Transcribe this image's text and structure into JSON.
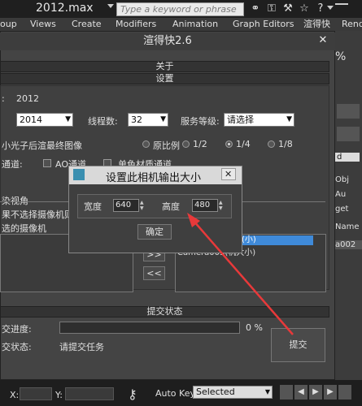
{
  "topbar": {
    "file_title": "2012.max",
    "search_placeholder": "Type a keyword or phrase",
    "menu": [
      "oup",
      "Views",
      "Create",
      "Modifiers",
      "Animation",
      "Graph Editors",
      "渲得快",
      "Rend"
    ]
  },
  "right_panel": {
    "obj_text": "Obj",
    "au_text": "Au",
    "get_text": "get",
    "name_text": "Name",
    "a002_text": "a002",
    "d_text": "d",
    "pct_text": "%"
  },
  "dialog": {
    "title": "渲得快2.6",
    "close": "✕",
    "section_about": "关于",
    "section_settings": "设置",
    "version_label": ":",
    "version_value": "2012",
    "max_version_value": "2014",
    "thread_label": "线程数:",
    "thread_value": "32",
    "service_label": "服务等级:",
    "service_value": "请选择",
    "final_render_text": "小光子后渲最终图像",
    "ratio_original": "原比例",
    "ratio_half": "1/2",
    "ratio_quarter": "1/4",
    "ratio_eighth": "1/8",
    "ratio_selected": "1/4",
    "channel_label": "通道:",
    "ao_channel": "AO通道",
    "mono_channel": "单色材质通道",
    "render_view_label": "染视角",
    "camera_hint": "果不选择摄像机则",
    "selected_camera": "选的摄像机",
    "camera_list_item_1": "(小)",
    "camera_list_item_2": "Camera003(机大小)",
    "move_right": ">>",
    "move_left": "<<",
    "section_submit_status": "提交状态",
    "progress_label": "交进度:",
    "progress_pct": "0 %",
    "progress_value": 0,
    "status_label": "交状态:",
    "status_value": "请提交任务",
    "submit_button": "提交"
  },
  "modal": {
    "title": "设置此相机输出大小",
    "close": "✕",
    "width_label": "宽度",
    "width_value": "640",
    "height_label": "高度",
    "height_value": "480",
    "ok_button": "确定"
  },
  "statusbar": {
    "x_label": "X:",
    "y_label": "Y:",
    "autokey": "Auto Key",
    "selected_value": "Selected"
  },
  "colors": {
    "annotation_arrow": "#e8393a"
  }
}
